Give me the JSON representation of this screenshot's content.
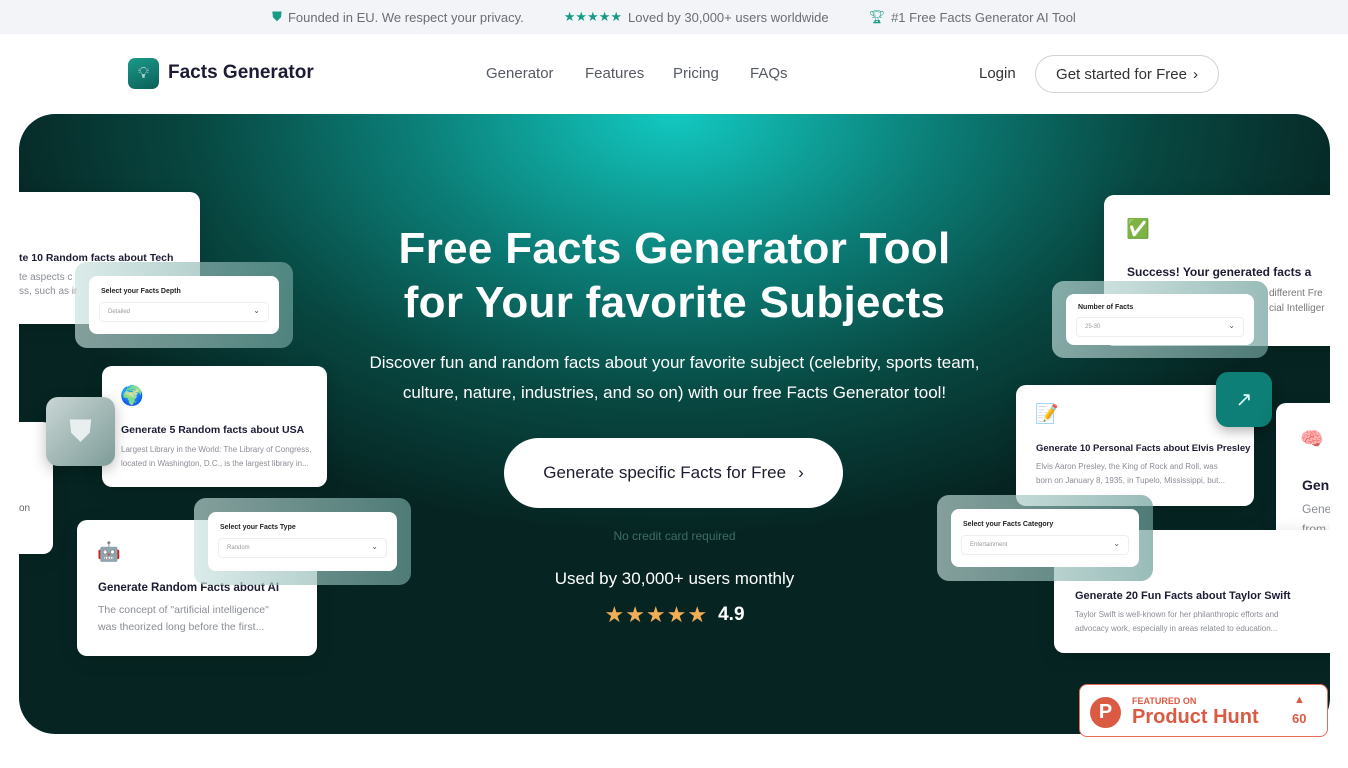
{
  "topbar": {
    "items": [
      {
        "icon": "shield-icon",
        "text": "Founded in EU. We respect your privacy."
      },
      {
        "icon": "stars-icon",
        "glyph": "★★★★★",
        "text": "Loved by 30,000+ users worldwide"
      },
      {
        "icon": "trophy-icon",
        "text": "#1 Free Facts Generator AI Tool"
      }
    ]
  },
  "nav": {
    "brand": "Facts Generator",
    "links": [
      "Generator",
      "Features",
      "Pricing",
      "FAQs"
    ],
    "login": "Login",
    "cta": "Get started for Free"
  },
  "hero": {
    "title_line1": "Free Facts Generator Tool",
    "title_line2": "for Your favorite Subjects",
    "subtitle_line1": "Discover fun and random facts about your favorite subject (celebrity, sports team,",
    "subtitle_line2": "culture, nature, industries, and so on) with our free Facts Generator tool!",
    "cta": "Generate specific Facts for Free",
    "no_credit": "No credit card required",
    "used_by": "Used by 30,000+ users monthly",
    "stars": "★★★★★",
    "rating": "4.9"
  },
  "cards": {
    "tech": {
      "title": "te 10 Random facts about Tech",
      "desc1": "te aspects c",
      "desc2": "ss, such as ir"
    },
    "usa": {
      "emoji": "🌍",
      "title": "Generate 5 Random facts about USA",
      "desc1": "Largest Library in the World: The Library of Congress,",
      "desc2": "located in Washington, D.C., is the largest library in..."
    },
    "left_partial": {
      "text": "on"
    },
    "ai": {
      "emoji": "🤖",
      "title": "Generate Random Facts about AI",
      "desc1": "The concept of \"artificial intelligence\"",
      "desc2": "was theorized long before the first..."
    },
    "success": {
      "emoji": "✅",
      "title": "Success! Your generated facts a",
      "desc1": "different Fre",
      "desc2": "cial Intelliger"
    },
    "elvis": {
      "emoji": "📝",
      "title": "Generate 10 Personal Facts about Elvis Presley",
      "desc1": "Elvis Aaron Presley, the King of Rock and Roll, was",
      "desc2": "born on January 8, 1935, in Tupelo, Mississippi, but..."
    },
    "brain": {
      "emoji": "🧠",
      "title": "Gen",
      "desc1": "Gene",
      "desc2": "from"
    },
    "taylor": {
      "title": "Generate 20 Fun Facts about Taylor Swift",
      "desc1": "Taylor Swift is well-known for her philanthropic efforts and",
      "desc2": "advocacy work, especially in areas related to education..."
    }
  },
  "selects": {
    "depth": {
      "label": "Select your Facts Depth",
      "value": "Detailed"
    },
    "type": {
      "label": "Select your Facts Type",
      "value": "Random"
    },
    "number": {
      "label": "Number of Facts",
      "value": "25-30"
    },
    "category": {
      "label": "Select your Facts Category",
      "value": "Entertainment"
    }
  },
  "product_hunt": {
    "featured": "FEATURED ON",
    "name": "Product Hunt",
    "count": "60",
    "color": "#da5a43"
  },
  "colors": {
    "accent": "#179c87",
    "hero_top": "#12c9c1",
    "hero_bottom": "#062522",
    "stars": "#f2ae57"
  }
}
